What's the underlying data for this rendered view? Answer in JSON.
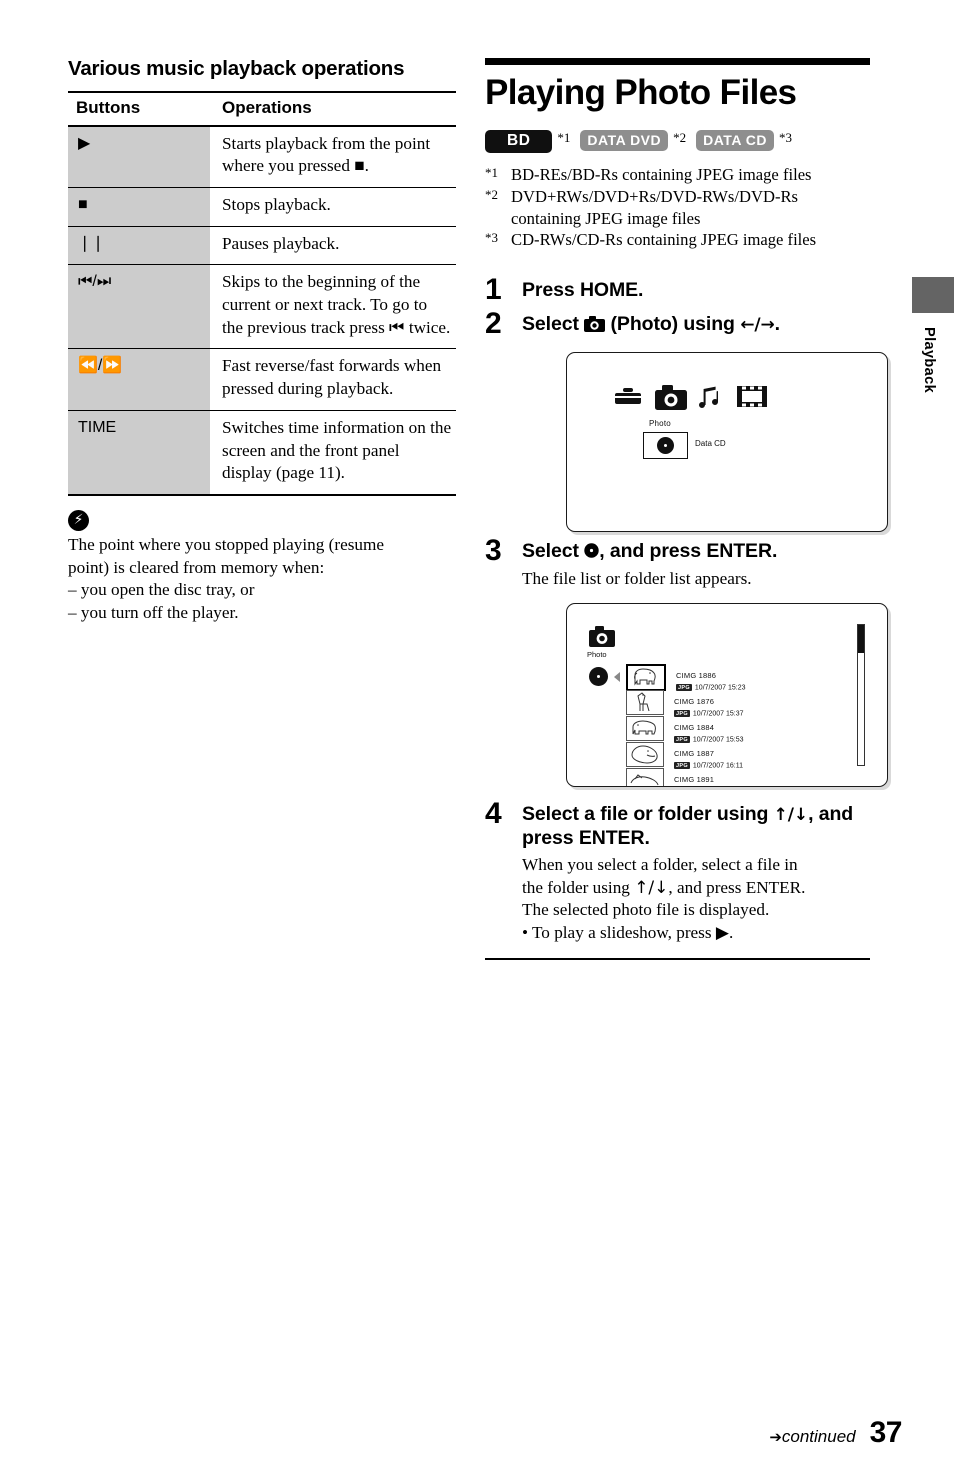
{
  "left": {
    "section_title": "Various music playback operations",
    "table": {
      "headers": [
        "Buttons",
        "Operations"
      ],
      "rows": [
        {
          "button": "▶",
          "operation": "Starts playback from the point where you pressed ■."
        },
        {
          "button": "■",
          "operation": "Stops playback."
        },
        {
          "button": "❘❘",
          "operation": "Pauses playback."
        },
        {
          "button": "⏮/⏭",
          "operation": "Skips to the beginning of the current or next track. To go to the previous track press ⏮ twice."
        },
        {
          "button": "⏪/⏩",
          "operation": "Fast reverse/fast forwards when pressed during playback."
        },
        {
          "button": "TIME",
          "operation": "Switches time information on the screen and the front panel display (page 11)."
        }
      ]
    },
    "note": {
      "icon": "note-lightning-icon",
      "line1": "The point where you stopped playing (resume",
      "line2": "point) is cleared from memory when:",
      "line3": "– you open the disc tray, or",
      "line4": "– you turn off the player."
    }
  },
  "right": {
    "heading": "Playing Photo Files",
    "badges": [
      {
        "label": "BD",
        "sup": "*1",
        "style": "black"
      },
      {
        "label": "DATA DVD",
        "sup": "*2",
        "style": "gray"
      },
      {
        "label": "DATA CD",
        "sup": "*3",
        "style": "gray"
      }
    ],
    "footnotes": [
      {
        "mark": "*1",
        "text": "BD-REs/BD-Rs containing JPEG image files"
      },
      {
        "mark": "*2",
        "text": "DVD+RWs/DVD+Rs/DVD-RWs/DVD-Rs containing JPEG image files"
      },
      {
        "mark": "*3",
        "text": "CD-RWs/CD-Rs containing JPEG image files"
      }
    ],
    "steps": {
      "step1": {
        "num": "1",
        "head": "Press HOME."
      },
      "step2": {
        "num": "2",
        "head_a": "Select",
        "head_icon": "camera-photo-icon",
        "head_b": "(Photo) using",
        "head_arrows": "←/→",
        "head_c": "."
      },
      "step3": {
        "num": "3",
        "head_a": "Select",
        "head_icon": "disc-icon",
        "head_b": ", and press ENTER.",
        "sub": "The file list or folder list appears."
      },
      "step4": {
        "num": "4",
        "head_a": "Select a file or folder using",
        "head_arrows": "↑/↓",
        "head_b": ", and press ENTER.",
        "sub_line1": "When you select a folder, select a file in",
        "sub_line2_a": "the folder using",
        "sub_line2_arrows": "↑/↓",
        "sub_line2_b": ", and press ENTER.",
        "sub_line3": "The selected photo file is displayed.",
        "bullet_a": "• To play a slideshow, press",
        "bullet_icon": "▶",
        "bullet_b": "."
      }
    },
    "home_screen": {
      "icons": [
        "toolbox-setup-icon",
        "camera-photo-icon",
        "music-note-icon",
        "film-strip-icon"
      ],
      "selected_label": "Photo",
      "disc_item_label": "Data CD"
    },
    "list_screen": {
      "category_icon": "camera-photo-icon",
      "category_label": "Photo",
      "source_icon": "disc-icon",
      "files": [
        {
          "name": "CIMG 1886",
          "type": "JPG",
          "date": "10/7/2007",
          "time": "15:23",
          "selected": true
        },
        {
          "name": "CIMG 1876",
          "type": "JPG",
          "date": "10/7/2007",
          "time": "15:37",
          "selected": false
        },
        {
          "name": "CIMG 1884",
          "type": "JPG",
          "date": "10/7/2007",
          "time": "15:53",
          "selected": false
        },
        {
          "name": "CIMG 1887",
          "type": "JPG",
          "date": "10/7/2007",
          "time": "16:11",
          "selected": false
        },
        {
          "name": "CIMG 1891",
          "type": "JPG",
          "date": "",
          "time": "",
          "selected": false
        }
      ]
    }
  },
  "side_tab": {
    "label": "Playback",
    "color": "#646464"
  },
  "footer": {
    "continued": "continued",
    "page_number": "37"
  }
}
